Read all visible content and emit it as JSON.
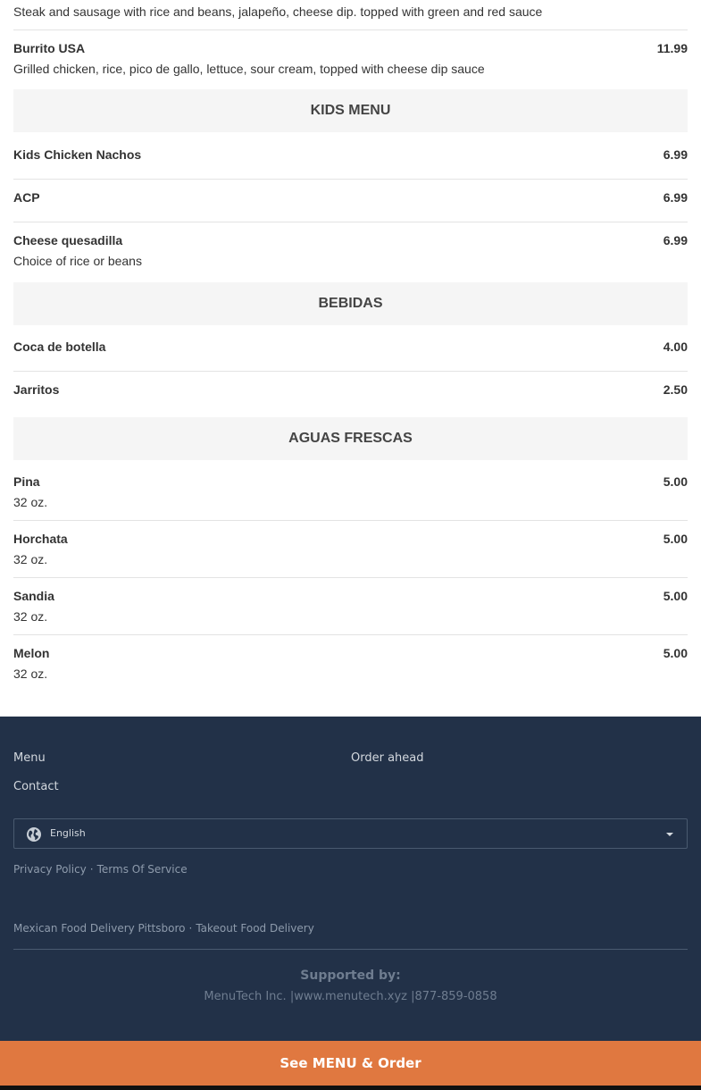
{
  "menu": {
    "top_description": "Steak and sausage with rice and beans, jalapeño, cheese dip. topped with green and red sauce",
    "burrito_usa": {
      "name": "Burrito USA",
      "price": "11.99",
      "desc": "Grilled chicken, rice, pico de gallo, lettuce, sour cream, topped with cheese dip sauce"
    },
    "kids_heading": "KIDS MENU",
    "kids": [
      {
        "name": "Kids Chicken Nachos",
        "price": "6.99"
      },
      {
        "name": "ACP",
        "price": "6.99"
      },
      {
        "name": "Cheese quesadilla",
        "price": "6.99",
        "desc": "Choice of rice or beans"
      }
    ],
    "bebidas_heading": "BEBIDAS",
    "bebidas": [
      {
        "name": "Coca de botella",
        "price": "4.00"
      },
      {
        "name": "Jarritos",
        "price": "2.50"
      }
    ],
    "aguas_heading": "AGUAS FRESCAS",
    "aguas": [
      {
        "name": "Pina",
        "price": "5.00",
        "desc": "32 oz."
      },
      {
        "name": "Horchata",
        "price": "5.00",
        "desc": "32 oz."
      },
      {
        "name": "Sandia",
        "price": "5.00",
        "desc": "32 oz."
      },
      {
        "name": "Melon",
        "price": "5.00",
        "desc": "32 oz."
      }
    ]
  },
  "footer": {
    "menu_link": "Menu",
    "order_ahead_link": "Order ahead",
    "contact_link": "Contact",
    "language": "English",
    "privacy": "Privacy Policy",
    "terms": "Terms Of Service",
    "delivery_link": "Mexican Food Delivery Pittsboro",
    "takeout_link": "Takeout Food Delivery",
    "supported_by": "Supported by:",
    "company_line": "MenuTech Inc. |www.menutech.xyz |877-859-0858"
  },
  "cta": {
    "label": "See MENU & Order"
  },
  "colors": {
    "footer_bg": "#223148",
    "cta_bg": "#e07840",
    "section_bg": "#f5f5f5"
  },
  "icons": {
    "language": "globe-icon",
    "dropdown": "caret-down-icon"
  }
}
